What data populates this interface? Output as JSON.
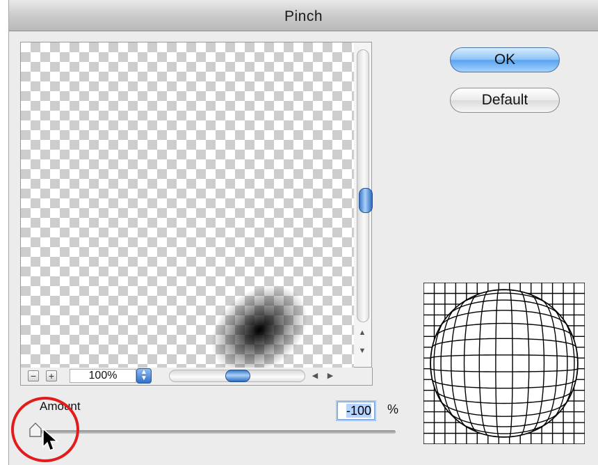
{
  "window": {
    "title": "Pinch"
  },
  "buttons": {
    "ok_label": "OK",
    "default_label": "Default"
  },
  "preview": {
    "zoom_out_label": "−",
    "zoom_in_label": "+",
    "zoom_value": "100%"
  },
  "amount": {
    "label": "Amount",
    "value": "-100",
    "unit": "%",
    "slider_min": -100,
    "slider_max": 100,
    "slider_value": -100
  },
  "colors": {
    "accent": "#2c6bc4",
    "highlight_circle": "#e21b1b"
  },
  "icons": [
    "zoom-out-icon",
    "zoom-in-icon",
    "stepper-icon",
    "arrow-up-icon",
    "arrow-down-icon",
    "arrow-left-icon",
    "arrow-right-icon",
    "pointer-cursor-icon"
  ]
}
